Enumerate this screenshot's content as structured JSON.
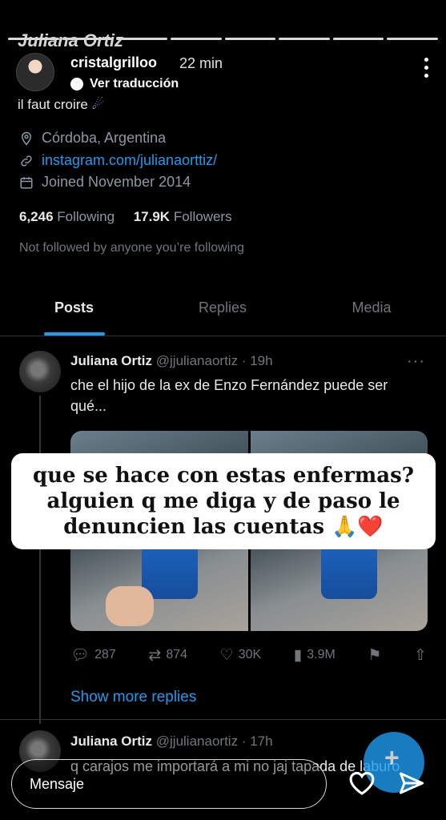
{
  "story": {
    "background_name": "Juliana Ortiz",
    "username": "cristalgrilloo",
    "time": "22 min",
    "translate_label": "Ver traducción",
    "reply_placeholder": "Mensaje"
  },
  "profile": {
    "bio": "il faut croire",
    "location": "Córdoba, Argentina",
    "link": "instagram.com/julianaorttiz/",
    "joined": "Joined November 2014",
    "following_count": "6,246",
    "following_label": "Following",
    "followers_count": "17.9K",
    "followers_label": "Followers",
    "not_followed": "Not followed by anyone you’re following"
  },
  "tabs": [
    {
      "label": "Posts",
      "active": true
    },
    {
      "label": "Replies",
      "active": false
    },
    {
      "label": "Media",
      "active": false
    }
  ],
  "tweets": [
    {
      "name": "Juliana Ortiz",
      "handle": "@jjulianaortiz",
      "time": "19h",
      "text": "che el hijo de la ex de Enzo Fernández puede ser qué...",
      "replies": "287",
      "retweets": "874",
      "likes": "30K",
      "views": "3.9M"
    },
    {
      "name": "Juliana Ortiz",
      "handle": "@jjulianaortiz",
      "time": "17h",
      "text": "q carajos me importará a mi no jaj tapada de laburo"
    }
  ],
  "overlay_caption": {
    "line1": "que se hace con estas enfermas?",
    "line2": "alguien q me diga y de paso le",
    "line3": "denuncien las cuentas 🙏❤️"
  },
  "show_more_replies": "Show more replies",
  "colors": {
    "accent": "#1d9bf0",
    "muted": "#71767b",
    "bg": "#000000"
  }
}
